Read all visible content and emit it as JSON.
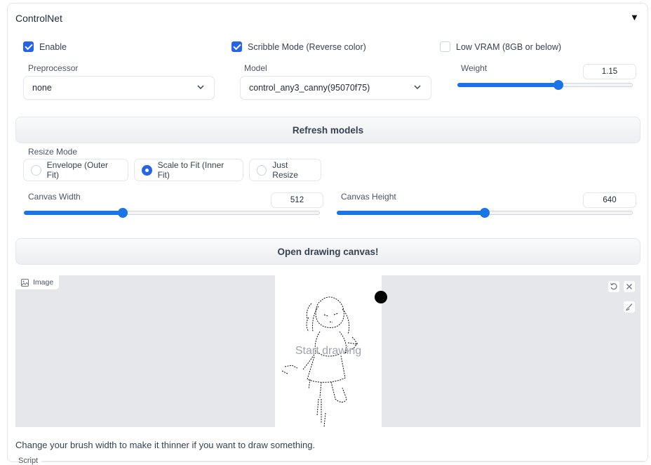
{
  "panel": {
    "title": "ControlNet",
    "collapse_icon": "triangle-down-icon"
  },
  "checkboxes": {
    "enable": {
      "label": "Enable",
      "checked": true
    },
    "scribble": {
      "label": "Scribble Mode (Reverse color)",
      "checked": true
    },
    "low_vram": {
      "label": "Low VRAM (8GB or below)",
      "checked": false
    }
  },
  "preprocessor": {
    "label": "Preprocessor",
    "value": "none"
  },
  "model": {
    "label": "Model",
    "value": "control_any3_canny(95070f75)"
  },
  "weight": {
    "label": "Weight",
    "value": "1.15",
    "min": 0,
    "max": 2
  },
  "refresh_button": "Refresh models",
  "resize_mode": {
    "label": "Resize Mode",
    "options": [
      "Envelope (Outer Fit)",
      "Scale to Fit (Inner Fit)",
      "Just Resize"
    ],
    "selected": "Scale to Fit (Inner Fit)"
  },
  "canvas_width": {
    "label": "Canvas Width",
    "value": "512",
    "min": 256,
    "max": 1024
  },
  "canvas_height": {
    "label": "Canvas Height",
    "value": "640",
    "min": 256,
    "max": 1024
  },
  "open_canvas_button": "Open drawing canvas!",
  "image": {
    "label": "Image",
    "placeholder": "Start drawing",
    "tools": [
      "undo-icon",
      "close-icon",
      "brush-icon"
    ]
  },
  "note": "Change your brush width to make it thinner if you want to draw something.",
  "script_label": "Script",
  "colors": {
    "accent": "#1a73e8",
    "checkbox": "#2563eb",
    "canvas_bg": "#e5e7eb"
  }
}
